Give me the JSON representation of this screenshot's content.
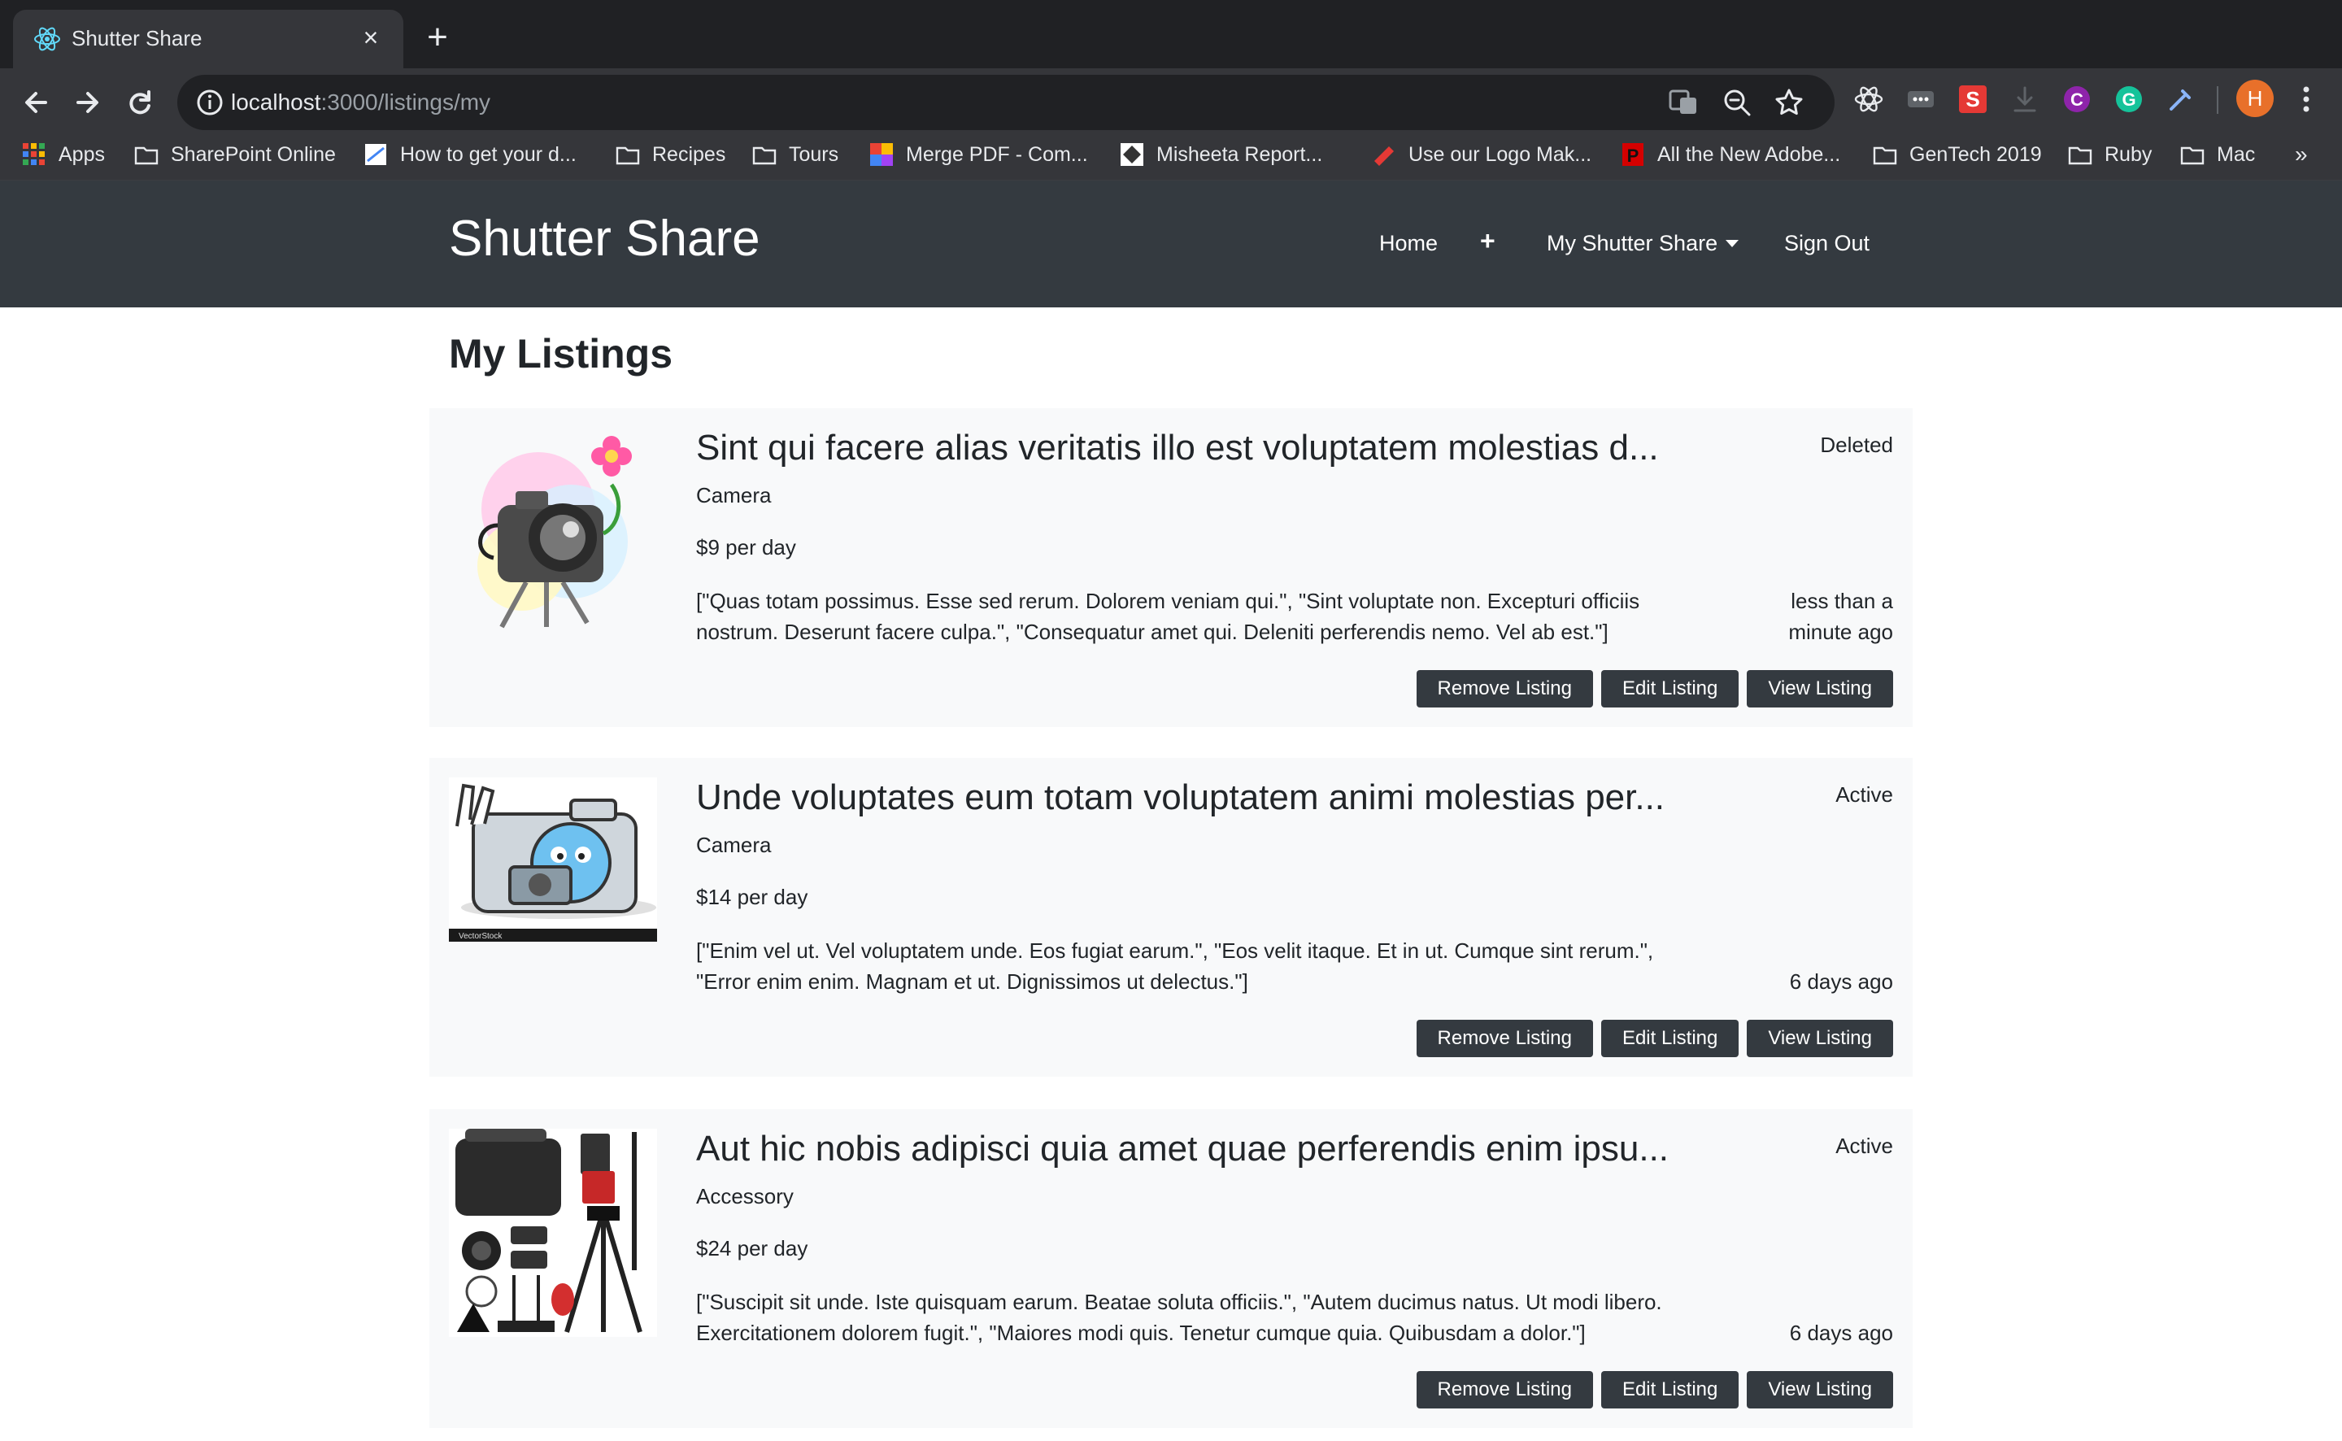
{
  "browser": {
    "tab_title": "Shutter Share",
    "url_host": "localhost",
    "url_path": ":3000/listings/my",
    "avatar_initial": "H",
    "bookmarks": [
      {
        "label": "Apps",
        "icon": "apps-grid-icon"
      },
      {
        "label": "SharePoint Online",
        "icon": "folder-icon"
      },
      {
        "label": "How to get your d...",
        "icon": "page-favicon-icon"
      },
      {
        "label": "Recipes",
        "icon": "folder-icon"
      },
      {
        "label": "Tours",
        "icon": "folder-icon"
      },
      {
        "label": "Merge PDF - Com...",
        "icon": "colorful-favicon-icon"
      },
      {
        "label": "Misheeta Report...",
        "icon": "site-favicon-icon"
      },
      {
        "label": "Use our Logo Mak...",
        "icon": "logo-favicon-icon"
      },
      {
        "label": "All the New Adobe...",
        "icon": "p-favicon-icon"
      },
      {
        "label": "GenTech 2019",
        "icon": "folder-icon"
      },
      {
        "label": "Ruby",
        "icon": "folder-icon"
      },
      {
        "label": "Mac",
        "icon": "folder-icon"
      }
    ],
    "bookmarks_more": "»"
  },
  "navbar": {
    "brand": "Shutter Share",
    "home": "Home",
    "add": "+",
    "my_shutter_share": "My Shutter Share",
    "sign_out": "Sign Out"
  },
  "page": {
    "title": "My Listings"
  },
  "listings": [
    {
      "title": "Sint qui facere alias veritatis illo est voluptatem molestias d...",
      "category": "Camera",
      "price": "$9 per day",
      "description": "[\"Quas totam possimus. Esse sed rerum. Dolorem veniam qui.\", \"Sint voluptate non. Excepturi officiis nostrum. Deserunt facere culpa.\", \"Consequatur amet qui. Deleniti perferendis nemo. Vel ab est.\"]",
      "status": "Deleted",
      "time": "less than a minute ago",
      "image": "camera-cartoon-with-flower"
    },
    {
      "title": "Unde voluptates eum totam voluptatem animi molestias per...",
      "category": "Camera",
      "price": "$14 per day",
      "description": "[\"Enim vel ut. Vel voluptatem unde. Eos fugiat earum.\", \"Eos velit itaque. Et in ut. Cumque sint rerum.\", \"Error enim enim. Magnam et ut. Dignissimos ut delectus.\"]",
      "status": "Active",
      "time": "6 days ago",
      "image": "camera-cartoon-peace-sign",
      "image_caption": "VectorStock"
    },
    {
      "title": "Aut hic nobis adipisci quia amet quae perferendis enim ipsu...",
      "category": "Accessory",
      "price": "$24 per day",
      "description": "[\"Suscipit sit unde. Iste quisquam earum. Beatae soluta officiis.\", \"Autem ducimus natus. Ut modi libero. Exercitationem dolorem fugit.\", \"Maiores modi quis. Tenetur cumque quia. Quibusdam a dolor.\"]",
      "status": "Active",
      "time": "6 days ago",
      "image": "camera-accessories-kit"
    }
  ],
  "buttons": {
    "remove": "Remove Listing",
    "edit": "Edit Listing",
    "view": "View Listing"
  },
  "colors": {
    "navbar_bg": "#343a40",
    "card_bg": "#f8f9fa",
    "button_bg": "#343a40",
    "browser_dark": "#202124",
    "browser_toolbar": "#35363a"
  }
}
